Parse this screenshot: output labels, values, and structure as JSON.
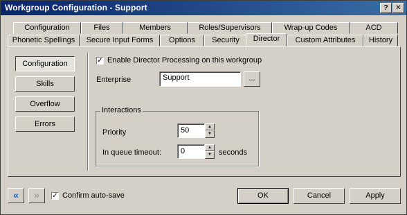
{
  "window": {
    "title": "Workgroup Configuration - Support",
    "help_glyph": "?",
    "close_glyph": "✕"
  },
  "tabs_back": [
    {
      "label": "Configuration"
    },
    {
      "label": "Files"
    },
    {
      "label": "Members"
    },
    {
      "label": "Roles/Supervisors"
    },
    {
      "label": "Wrap-up Codes"
    },
    {
      "label": "ACD"
    }
  ],
  "tabs_front": [
    {
      "label": "Phonetic Spellings"
    },
    {
      "label": "Secure Input Forms"
    },
    {
      "label": "Options"
    },
    {
      "label": "Security"
    },
    {
      "label": "Director",
      "active": true
    },
    {
      "label": "Custom Attributes"
    },
    {
      "label": "History"
    }
  ],
  "sidebar": {
    "items": [
      {
        "label": "Configuration",
        "selected": true
      },
      {
        "label": "Skills"
      },
      {
        "label": "Overflow"
      },
      {
        "label": "Errors"
      }
    ]
  },
  "director": {
    "enable_label": "Enable Director Processing on this workgroup",
    "enable_checked": true,
    "enterprise_label": "Enterprise",
    "enterprise_value": "Support",
    "browse_label": "...",
    "interactions_legend": "Interactions",
    "priority_label": "Priority",
    "priority_value": "50",
    "timeout_label": "In queue timeout:",
    "timeout_value": "0",
    "timeout_units": "seconds"
  },
  "footer": {
    "prev_glyph": "«",
    "next_glyph": "»",
    "confirm_label": "Confirm auto-save",
    "confirm_checked": true,
    "ok_label": "OK",
    "cancel_label": "Cancel",
    "apply_label": "Apply"
  },
  "colors": {
    "title_gradient_start": "#0a246a",
    "title_gradient_end": "#3a6ea5",
    "face": "#d4d0c8",
    "nav_arrow_active": "#1f5fbf"
  }
}
